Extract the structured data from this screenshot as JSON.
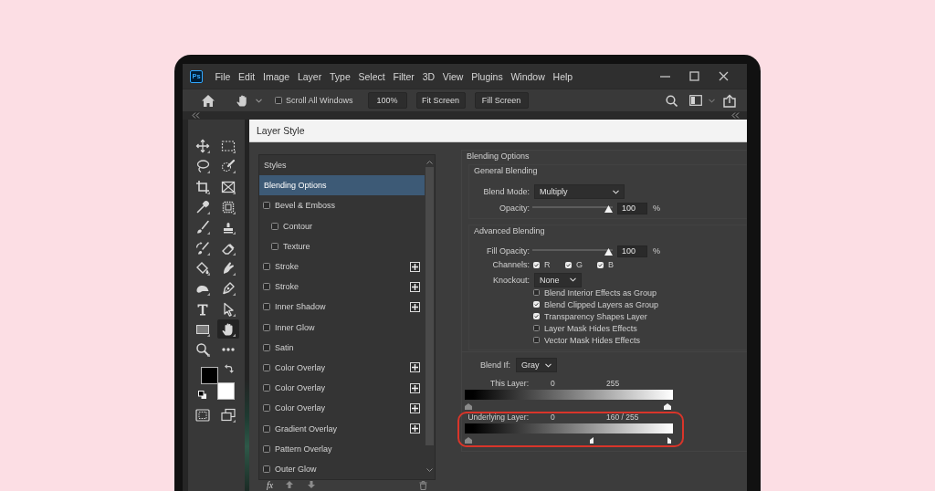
{
  "menu_bar": {
    "logo": "Ps",
    "items": [
      "File",
      "Edit",
      "Image",
      "Layer",
      "Type",
      "Select",
      "Filter",
      "3D",
      "View",
      "Plugins",
      "Window",
      "Help"
    ]
  },
  "options_bar": {
    "scroll_all_windows": {
      "label": "Scroll All Windows",
      "checked": false
    },
    "buttons": [
      "100%",
      "Fit Screen",
      "Fill Screen"
    ]
  },
  "tools": [
    {
      "kind": "move",
      "selected": false
    },
    {
      "kind": "marquee",
      "selected": false
    },
    {
      "kind": "lasso",
      "selected": false
    },
    {
      "kind": "quick-select",
      "selected": false
    },
    {
      "kind": "crop",
      "selected": false
    },
    {
      "kind": "frame",
      "selected": false
    },
    {
      "kind": "eyedropper",
      "selected": false
    },
    {
      "kind": "dotted-square",
      "selected": false
    },
    {
      "kind": "brush",
      "selected": false
    },
    {
      "kind": "stamp",
      "selected": false
    },
    {
      "kind": "history-brush",
      "selected": false
    },
    {
      "kind": "eraser",
      "selected": false
    },
    {
      "kind": "bucket",
      "selected": false
    },
    {
      "kind": "smudge",
      "selected": false
    },
    {
      "kind": "dodge",
      "selected": false
    },
    {
      "kind": "pen",
      "selected": false
    },
    {
      "kind": "type",
      "selected": false
    },
    {
      "kind": "path-select",
      "selected": false
    },
    {
      "kind": "rectangle",
      "selected": false
    },
    {
      "kind": "hand",
      "selected": true
    },
    {
      "kind": "zoom",
      "selected": false
    },
    {
      "kind": "more",
      "selected": false
    }
  ],
  "swatches": [
    {
      "kind": "foreground",
      "color": "#000000"
    },
    {
      "kind": "background",
      "color": "#ffffff"
    }
  ],
  "modes": [
    {
      "kind": "quick-mask"
    },
    {
      "kind": "screen-mode"
    }
  ],
  "dialog": {
    "title": "Layer Style",
    "styles": [
      {
        "label": "Styles",
        "kind": "plain",
        "selected": false
      },
      {
        "label": "Blending Options",
        "kind": "plain",
        "selected": true
      },
      {
        "label": "Bevel & Emboss",
        "kind": "check",
        "checked": false,
        "selected": false,
        "addable": false,
        "children": [
          {
            "label": "Contour",
            "kind": "check",
            "checked": false,
            "selected": false,
            "addable": false
          },
          {
            "label": "Texture",
            "kind": "check",
            "checked": false,
            "selected": false,
            "addable": false
          }
        ]
      },
      {
        "label": "Stroke",
        "kind": "check",
        "checked": false,
        "selected": false,
        "addable": true
      },
      {
        "label": "Stroke",
        "kind": "check",
        "checked": false,
        "selected": false,
        "addable": true
      },
      {
        "label": "Inner Shadow",
        "kind": "check",
        "checked": false,
        "selected": false,
        "addable": true
      },
      {
        "label": "Inner Glow",
        "kind": "check",
        "checked": false,
        "selected": false,
        "addable": false
      },
      {
        "label": "Satin",
        "kind": "check",
        "checked": false,
        "selected": false,
        "addable": false
      },
      {
        "label": "Color Overlay",
        "kind": "check",
        "checked": false,
        "selected": false,
        "addable": true
      },
      {
        "label": "Color Overlay",
        "kind": "check",
        "checked": false,
        "selected": false,
        "addable": true
      },
      {
        "label": "Color Overlay",
        "kind": "check",
        "checked": false,
        "selected": false,
        "addable": true
      },
      {
        "label": "Gradient Overlay",
        "kind": "check",
        "checked": false,
        "selected": false,
        "addable": true
      },
      {
        "label": "Pattern Overlay",
        "kind": "check",
        "checked": false,
        "selected": false,
        "addable": false
      },
      {
        "label": "Outer Glow",
        "kind": "check",
        "checked": false,
        "selected": false,
        "addable": false
      }
    ],
    "footer": {
      "effects_button": "fx"
    },
    "blending": {
      "title": "Blending Options",
      "general": {
        "title": "General Blending",
        "blend_mode": {
          "label": "Blend Mode:",
          "value": "Multiply"
        },
        "opacity": {
          "label": "Opacity:",
          "level": 1,
          "value": "100",
          "unit": "%"
        }
      },
      "advanced": {
        "title": "Advanced Blending",
        "fill_opacity": {
          "label": "Fill Opacity:",
          "level": 1,
          "value": "100",
          "unit": "%"
        },
        "channels": {
          "label": "Channels:",
          "items": [
            {
              "label": "R",
              "checked": true
            },
            {
              "label": "G",
              "checked": true
            },
            {
              "label": "B",
              "checked": true
            }
          ]
        },
        "knockout": {
          "label": "Knockout:",
          "value": "None"
        },
        "options": [
          {
            "label": "Blend Interior Effects as Group",
            "checked": false
          },
          {
            "label": "Blend Clipped Layers as Group",
            "checked": true
          },
          {
            "label": "Transparency Shapes Layer",
            "checked": true
          },
          {
            "label": "Layer Mask Hides Effects",
            "checked": false
          },
          {
            "label": "Vector Mask Hides Effects",
            "checked": false
          }
        ]
      },
      "blend_if": {
        "label": "Blend If:",
        "value": "Gray",
        "sliders": [
          {
            "label": "This Layer:",
            "readings": [
              "0",
              "255"
            ],
            "highlighted": false,
            "thumbs": [
              {
                "kind": "black",
                "level": 0
              },
              {
                "kind": "white",
                "level": 1
              }
            ]
          },
          {
            "label": "Underlying Layer:",
            "readings": [
              "0",
              "160 / 255"
            ],
            "highlighted": true,
            "thumbs": [
              {
                "kind": "black",
                "level": 0
              },
              {
                "kind": "white-left",
                "level": 0.627
              },
              {
                "kind": "white-right",
                "level": 1
              }
            ]
          }
        ]
      }
    }
  }
}
